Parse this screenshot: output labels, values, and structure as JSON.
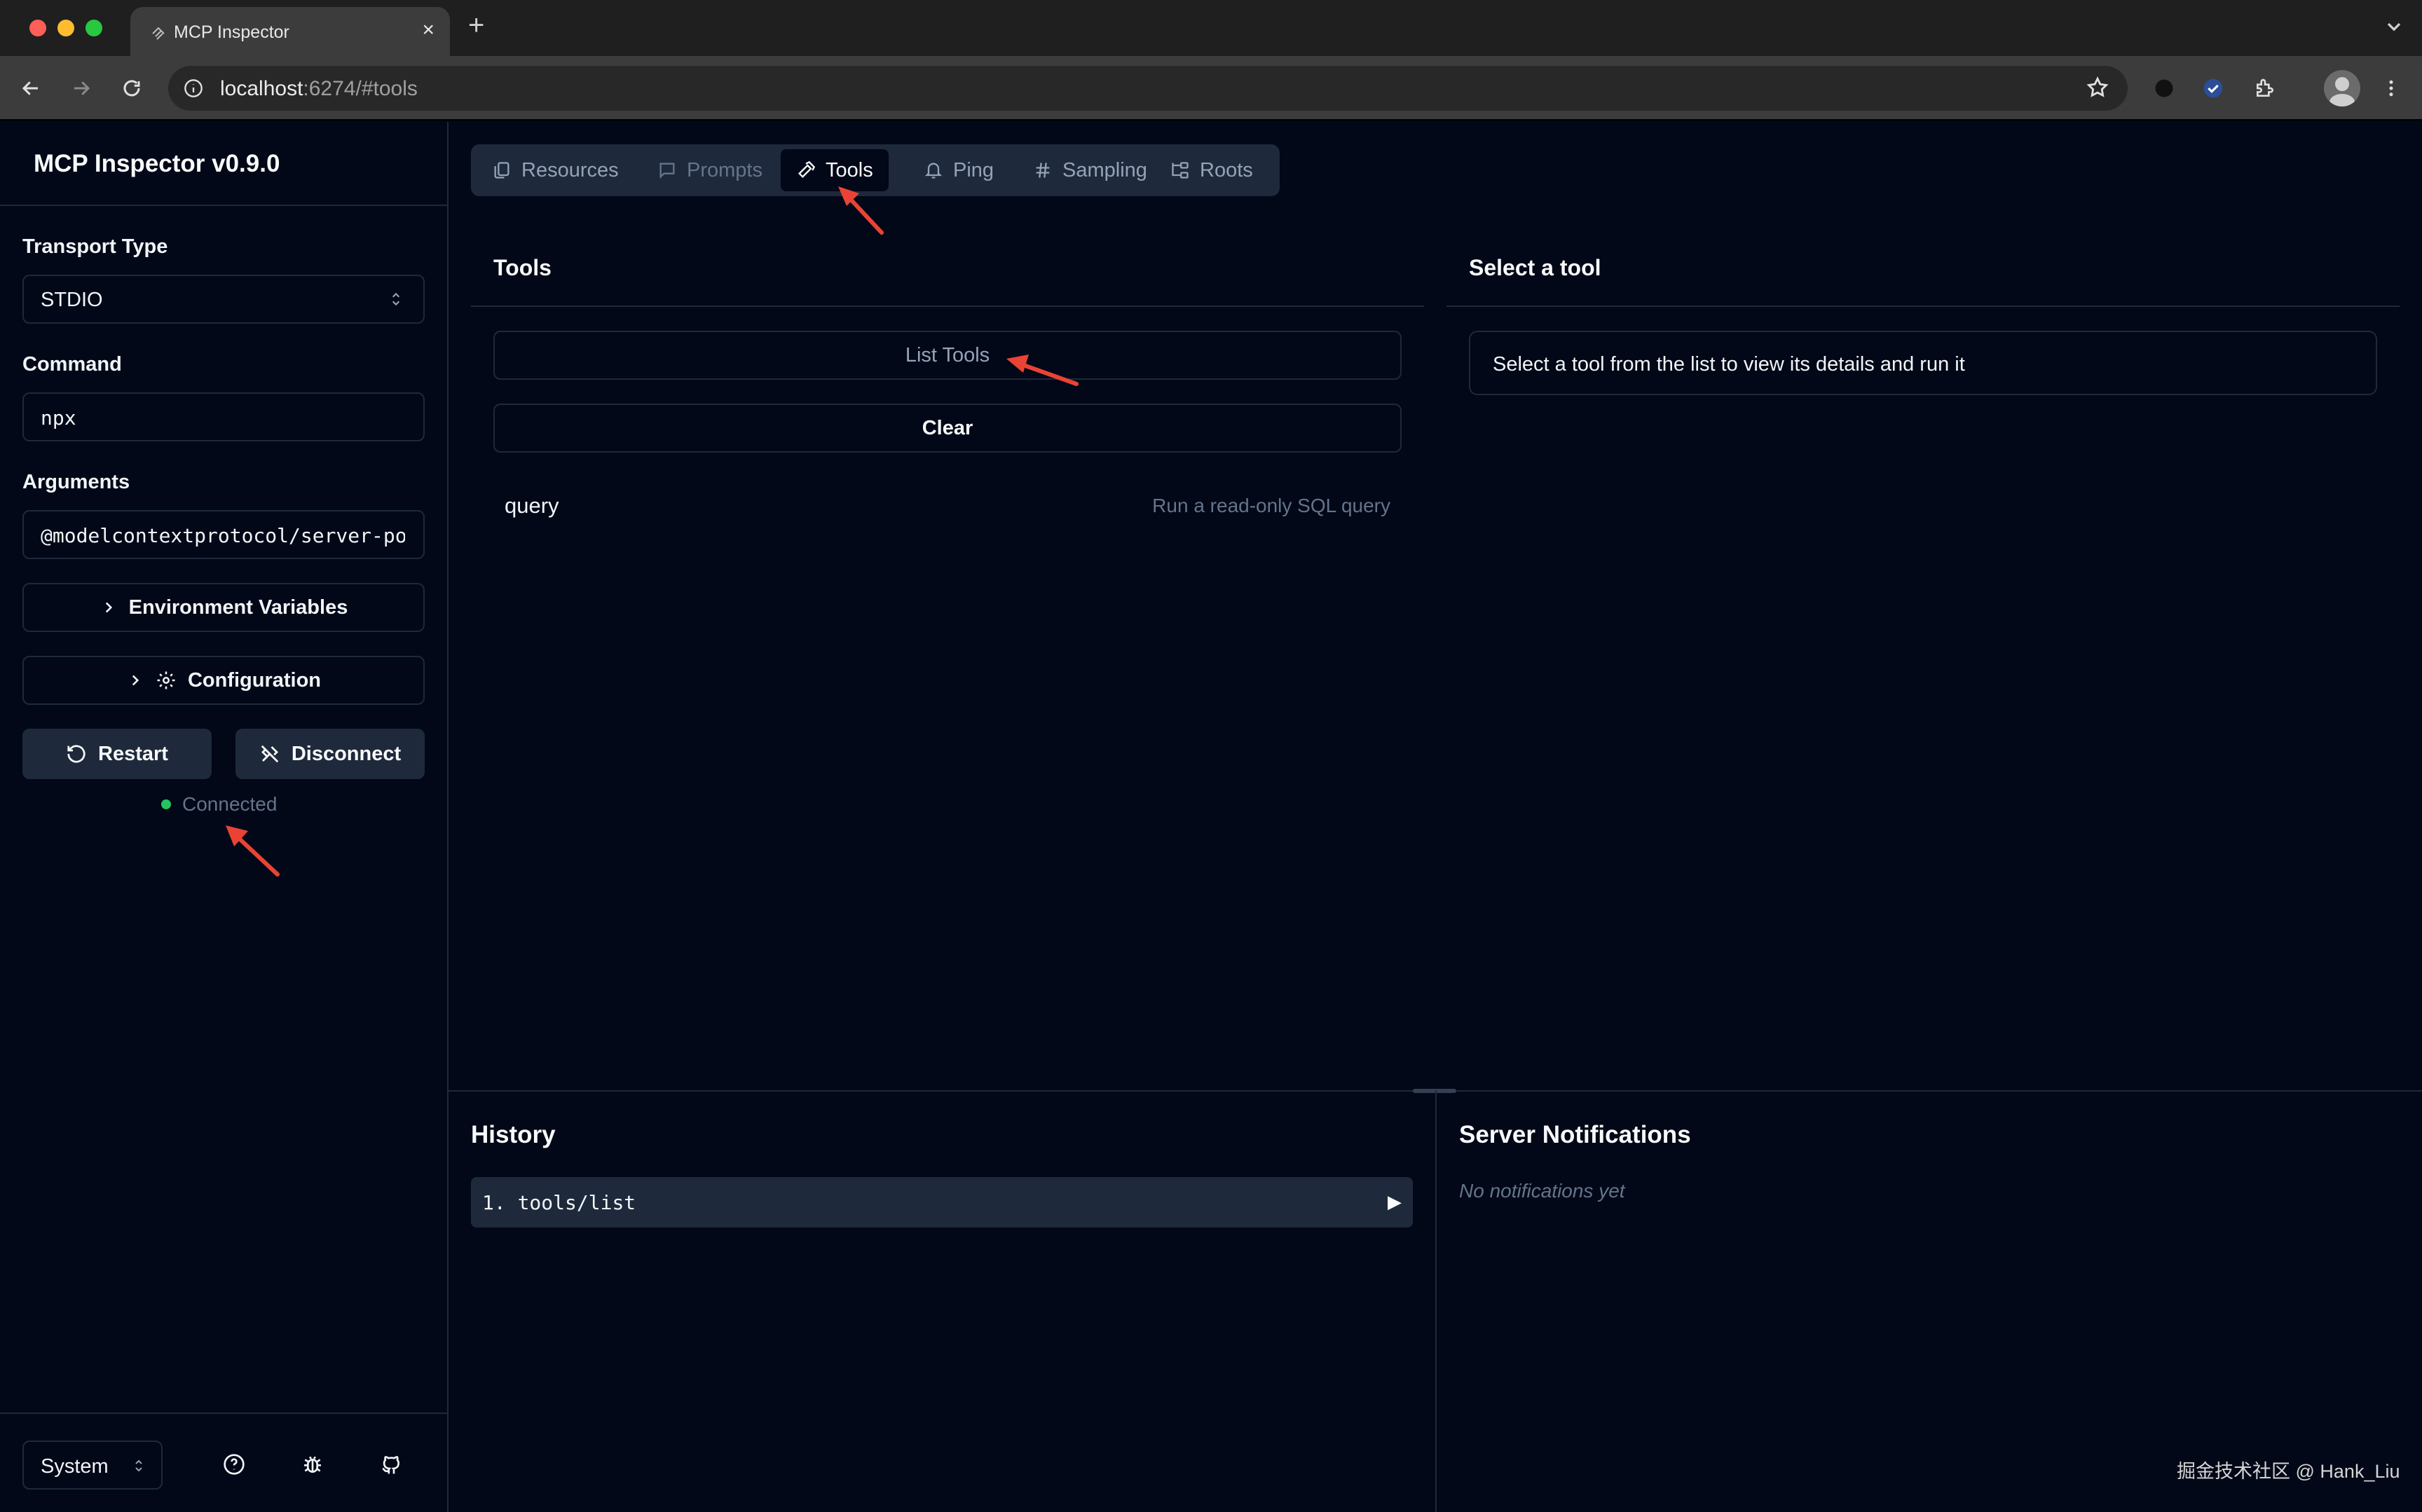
{
  "browser": {
    "tab_title": "MCP Inspector",
    "url_host": "localhost",
    "url_rest": ":6274/#tools"
  },
  "sidebar": {
    "app_title": "MCP Inspector v0.9.0",
    "transport_label": "Transport Type",
    "transport_value": "STDIO",
    "command_label": "Command",
    "command_value": "npx",
    "arguments_label": "Arguments",
    "arguments_value": "@modelcontextprotocol/server-po",
    "env_vars_label": "Environment Variables",
    "configuration_label": "Configuration",
    "restart_label": "Restart",
    "disconnect_label": "Disconnect",
    "status_text": "Connected",
    "status_color": "#22c55e",
    "theme_value": "System"
  },
  "tabs": [
    {
      "label": "Resources",
      "icon": "files-icon",
      "state": "normal"
    },
    {
      "label": "Prompts",
      "icon": "message-square-icon",
      "state": "disabled"
    },
    {
      "label": "Tools",
      "icon": "hammer-icon",
      "state": "active"
    },
    {
      "label": "Ping",
      "icon": "bell-icon",
      "state": "normal"
    },
    {
      "label": "Sampling",
      "icon": "hash-icon",
      "state": "normal"
    },
    {
      "label": "Roots",
      "icon": "folder-tree-icon",
      "state": "normal"
    }
  ],
  "tools_panel": {
    "title": "Tools",
    "list_button": "List Tools",
    "clear_button": "Clear",
    "tools": [
      {
        "name": "query",
        "description": "Run a read-only SQL query"
      }
    ]
  },
  "detail_panel": {
    "title": "Select a tool",
    "message": "Select a tool from the list to view its details and run it"
  },
  "history": {
    "title": "History",
    "items": [
      {
        "index": "1.",
        "method": "tools/list"
      }
    ]
  },
  "notifications": {
    "title": "Server Notifications",
    "empty_text": "No notifications yet"
  },
  "watermark": "掘金技术社区 @ Hank_Liu",
  "colors": {
    "background": "#020817",
    "border": "#1e293b",
    "muted_text": "#64748b",
    "annotation_arrow": "#ea4335"
  }
}
